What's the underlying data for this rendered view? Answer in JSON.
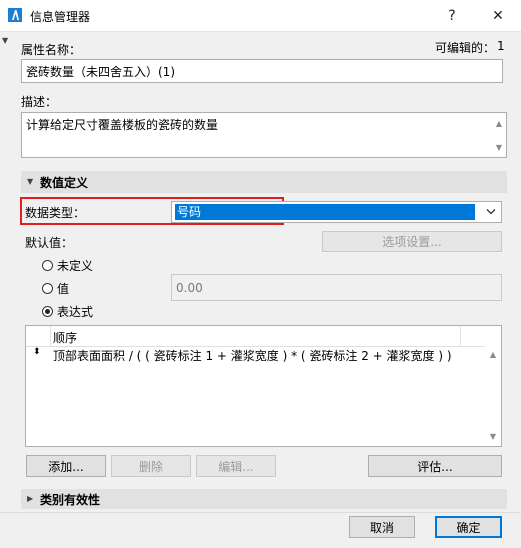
{
  "window": {
    "title": "信息管理器",
    "help": "?",
    "close": "✕"
  },
  "property_name": {
    "label": "属性名称：",
    "editable_label": "可编辑的：",
    "editable_count": "1",
    "value": "瓷砖数量（未四舍五入）(1)"
  },
  "description": {
    "label": "描述：",
    "value": "计算给定尺寸覆盖楼板的瓷砖的数量"
  },
  "value_definition": {
    "header": "数值定义",
    "data_type_label": "数据类型：",
    "data_type_value": "号码",
    "default_label": "默认值：",
    "options_button": "选项设置...",
    "radio_undefined": "未定义",
    "radio_value": "值",
    "value_field": "0.00",
    "radio_expression": "表达式",
    "selected_radio": "expression",
    "table_header": "顺序",
    "expression": "顶部表面面积 / ( ( 瓷砖标注 1 + 灌浆宽度 ) * ( 瓷砖标注 2 + 灌浆宽度 ) )"
  },
  "buttons": {
    "add": "添加...",
    "delete": "删除",
    "edit": "编辑...",
    "evaluate": "评估..."
  },
  "category_validity": {
    "header": "类别有效性"
  },
  "footer": {
    "cancel": "取消",
    "ok": "确定"
  },
  "colors": {
    "accent": "#0078d7",
    "highlight_border": "#e01e1e",
    "app_icon": "#1e7fd2"
  }
}
